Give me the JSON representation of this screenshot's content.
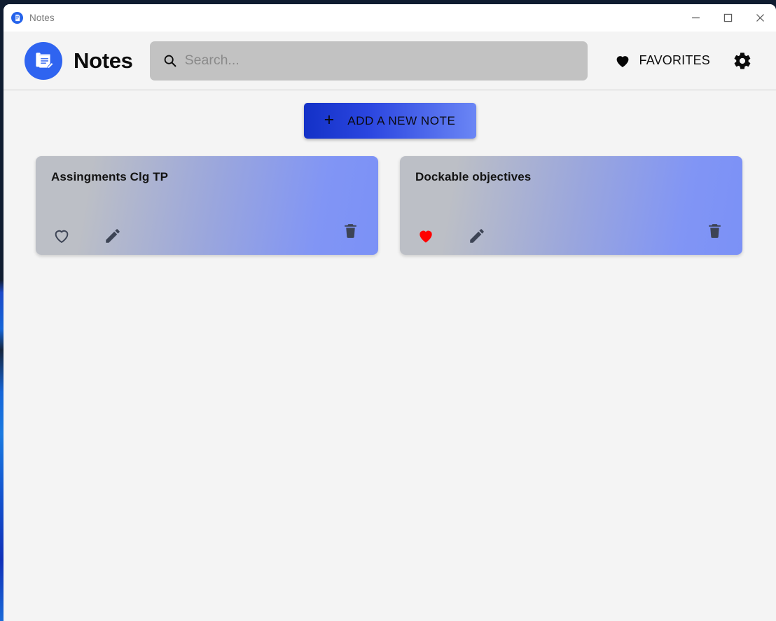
{
  "window": {
    "titlebar_title": "Notes",
    "app_icon": "notes-app-icon",
    "minimize_label": "Minimize",
    "maximize_label": "Maximize",
    "close_label": "Close"
  },
  "header": {
    "logo_icon": "notepad-pencil-icon",
    "app_title": "Notes",
    "search": {
      "icon": "search-icon",
      "value": "",
      "placeholder": "Search..."
    },
    "favorites": {
      "icon": "heart-filled-icon",
      "label": "FAVORITES"
    },
    "settings": {
      "icon": "gear-icon"
    }
  },
  "main": {
    "add_note": {
      "icon": "plus-icon",
      "plus": "+",
      "label": "ADD A NEW NOTE"
    },
    "notes": [
      {
        "title": "Assingments Clg TP",
        "favorite": false,
        "favorite_icon": "heart-outline-icon",
        "edit_icon": "pencil-icon",
        "delete_icon": "trash-icon"
      },
      {
        "title": "Dockable objectives",
        "favorite": true,
        "favorite_icon": "heart-filled-icon",
        "edit_icon": "pencil-icon",
        "delete_icon": "trash-icon"
      }
    ]
  },
  "colors": {
    "accent_blue": "#2f64f0",
    "button_gradient_start": "#1331c7",
    "button_gradient_end": "#6b86f5",
    "card_gradient_start": "#bcbfc6",
    "card_gradient_end": "#7b91f6",
    "favorite_red": "#ff0000",
    "icon_slate": "#3d4455",
    "page_background": "#f4f4f4",
    "search_background": "#c2c2c2"
  }
}
